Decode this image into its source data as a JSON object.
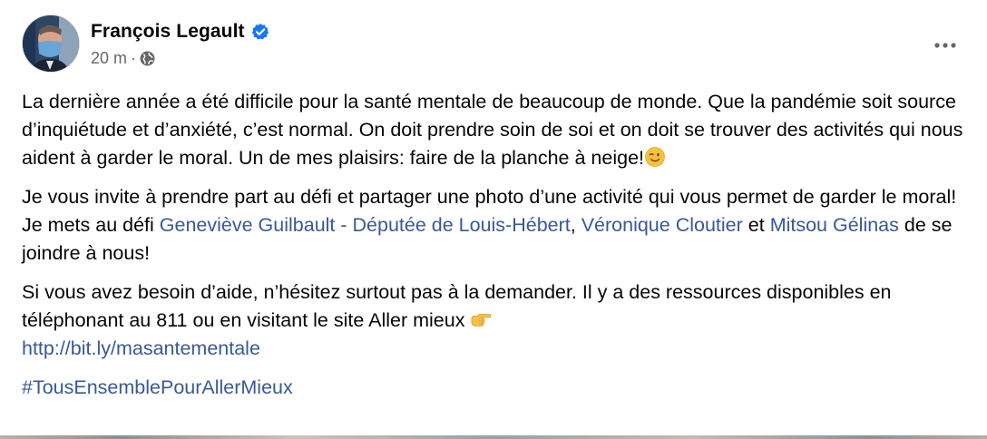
{
  "author": {
    "name": "François Legault",
    "verified": true
  },
  "meta": {
    "time": "20 m",
    "separator": "·",
    "audience_icon": "globe-icon"
  },
  "menu_icon": "more-options-icon",
  "body": {
    "p1": {
      "text": "La dernière année a été difficile pour la santé mentale de beaucoup de monde. Que la pandémie soit source d’inquiétude et d’anxiété, c’est normal. On doit prendre soin de soi et on doit se trouver des activités qui nous aident à garder le moral. Un de mes plaisirs: faire de la planche à neige!",
      "emoji": "winking-face-emoji"
    },
    "p2": {
      "before": "Je vous invite à prendre part au défi et partager une photo d’une activité qui vous permet de garder le moral! Je mets au défi ",
      "mention1": "Geneviève Guilbault - Députée de Louis-Hébert",
      "sep1": ", ",
      "mention2": "Véronique Cloutier",
      "sep2": " et ",
      "mention3": "Mitsou Gélinas",
      "after": " de se joindre à nous!"
    },
    "p3": {
      "text": "Si vous avez besoin d’aide, n’hésitez surtout pas à la demander. Il y a des ressources disponibles en téléphonant au 811 ou en visitant le site Aller mieux ",
      "emoji": "backhand-index-pointing-right-emoji",
      "link": "http://bit.ly/masantementale"
    },
    "hashtag": "#TousEnsemblePourAllerMieux"
  },
  "colors": {
    "link": "#385898",
    "text": "#050505",
    "meta": "#65676b",
    "verified": "#1877f2"
  }
}
